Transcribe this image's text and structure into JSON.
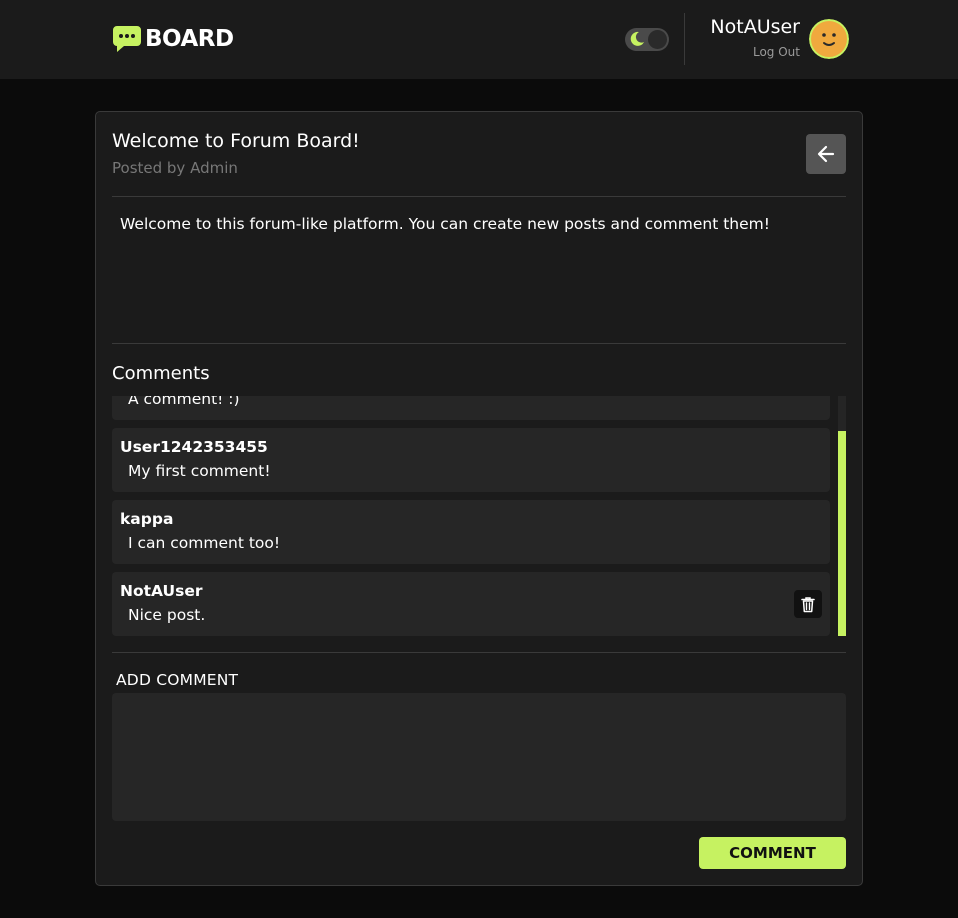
{
  "header": {
    "logo_text": "BOARD",
    "user": {
      "name": "NotAUser",
      "logout_label": "Log Out"
    }
  },
  "post": {
    "title": "Welcome to Forum Board!",
    "meta": "Posted by Admin",
    "body": "Welcome to this forum-like platform. You can create new posts and comment them!"
  },
  "comments": {
    "heading": "Comments",
    "items": [
      {
        "author": "",
        "text": "A comment! :)"
      },
      {
        "author": "User1242353455",
        "text": "My first comment!"
      },
      {
        "author": "kappa",
        "text": "I can comment too!"
      },
      {
        "author": "NotAUser",
        "text": "Nice post."
      }
    ]
  },
  "add_comment": {
    "label": "ADD COMMENT",
    "placeholder": "",
    "button_label": "COMMENT"
  },
  "colors": {
    "accent": "#c6f261",
    "header_bg": "#1b1b1b",
    "page_bg": "#0b0b0b",
    "card_bg": "#1b1b1b",
    "comment_bg": "#262626"
  },
  "icons": {
    "logo": "chat-bubble-icon",
    "theme": "moon-icon",
    "avatar": "smiley-face-icon",
    "back": "arrow-left-icon",
    "delete": "trash-icon"
  }
}
